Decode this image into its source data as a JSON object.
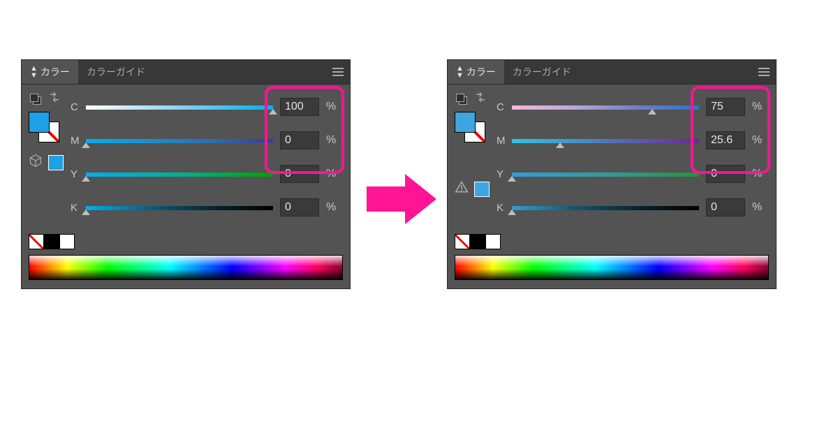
{
  "highlight_color": "#ff1493",
  "arrow_color": "#ff1493",
  "panels": {
    "left": {
      "tabs": {
        "active": "カラー",
        "inactive": "カラーガイド"
      },
      "fg_color": "#1f9fe6",
      "alt_swatch_color": "#1f9fe6",
      "alt_icon": "cube",
      "channels": {
        "C": {
          "value": "100",
          "percent": 100
        },
        "M": {
          "value": "0",
          "percent": 0
        },
        "Y": {
          "value": "0",
          "percent": 0
        },
        "K": {
          "value": "0",
          "percent": 0
        }
      },
      "unit": "%"
    },
    "right": {
      "tabs": {
        "active": "カラー",
        "inactive": "カラーガイド"
      },
      "fg_color": "#3da6e0",
      "alt_swatch_color": "#3da6e0",
      "alt_icon": "warning",
      "channels": {
        "C": {
          "value": "75",
          "percent": 75
        },
        "M": {
          "value": "25.6",
          "percent": 25.6
        },
        "Y": {
          "value": "0",
          "percent": 0
        },
        "K": {
          "value": "0",
          "percent": 0
        }
      },
      "unit": "%"
    }
  },
  "labels": {
    "C": "C",
    "M": "M",
    "Y": "Y",
    "K": "K"
  }
}
